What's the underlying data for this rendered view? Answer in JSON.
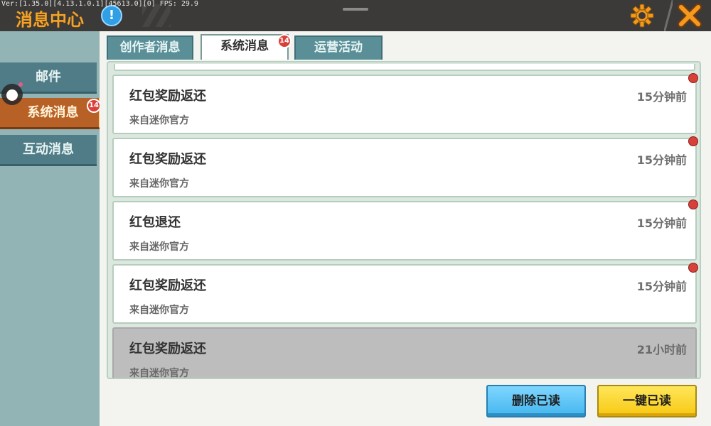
{
  "debug": "Ver:[1.35.0][4.13.1.0.1][45613.0][0] FPS: 29.9",
  "header": {
    "title": "消息中心",
    "info_glyph": "!"
  },
  "sidebar": {
    "items": [
      {
        "label": "邮件",
        "active": false
      },
      {
        "label": "系统消息",
        "active": true,
        "badge": "14"
      },
      {
        "label": "互动消息",
        "active": false
      }
    ]
  },
  "tabs": [
    {
      "label": "创作者消息",
      "active": false
    },
    {
      "label": "系统消息",
      "active": true,
      "badge": "14"
    },
    {
      "label": "运营活动",
      "active": false
    }
  ],
  "messages": [
    {
      "title": "红包奖励返还",
      "from": "来自迷你官方",
      "time": "15分钟前",
      "unread": true
    },
    {
      "title": "红包奖励返还",
      "from": "来自迷你官方",
      "time": "15分钟前",
      "unread": true
    },
    {
      "title": "红包退还",
      "from": "来自迷你官方",
      "time": "15分钟前",
      "unread": true
    },
    {
      "title": "红包奖励返还",
      "from": "来自迷你官方",
      "time": "15分钟前",
      "unread": true
    },
    {
      "title": "红包奖励返还",
      "from": "来自迷你官方",
      "time": "21小时前",
      "unread": false
    }
  ],
  "buttons": {
    "delete_read": "删除已读",
    "mark_all_read": "一键已读"
  },
  "colors": {
    "accent_orange": "#f3a32a",
    "unread_dot": "#d8413a",
    "tab_teal": "#5b8f98"
  }
}
